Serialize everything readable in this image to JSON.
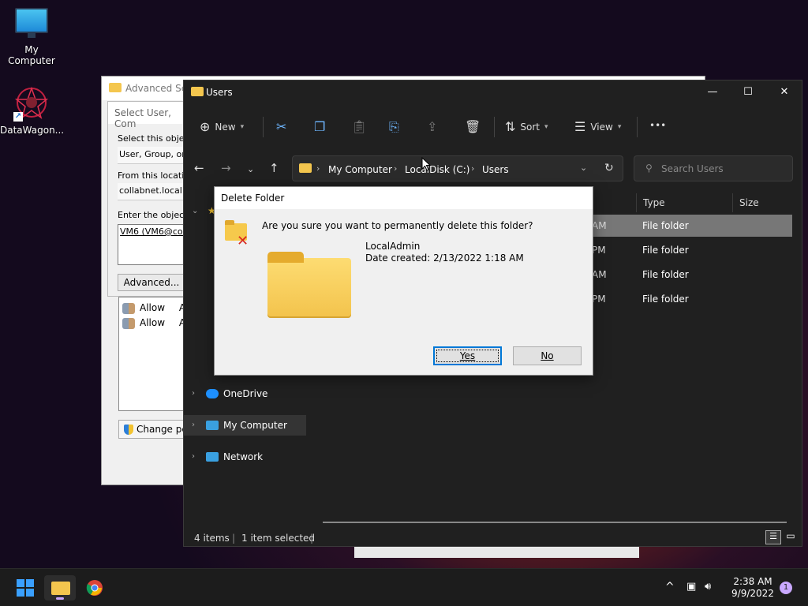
{
  "desktop": {
    "icons": [
      {
        "label": "My Computer"
      },
      {
        "label": "DataWagon..."
      }
    ]
  },
  "adv_security": {
    "title": "Advanced Sec",
    "select_user": {
      "title": "Select User, Com",
      "select_type_label": "Select this object",
      "select_type_value": "User, Group, or B",
      "location_label": "From this location:",
      "location_value": "collabnet.local",
      "enter_label": "Enter the object n",
      "enter_value": "VM6 (VM6@colla",
      "advanced_button": "Advanced..."
    },
    "permissions": [
      {
        "type": "Allow",
        "extra": "A"
      },
      {
        "type": "Allow",
        "extra": "A"
      }
    ],
    "change_button": "Change pe"
  },
  "explorer": {
    "title": "Users",
    "window_controls": {
      "minimize": "—",
      "maximize": "☐",
      "close": "✕"
    },
    "toolbar": {
      "new_label": "New",
      "sort_label": "Sort",
      "view_label": "View",
      "more_label": "•••"
    },
    "address": {
      "crumbs": [
        "My Computer",
        "LocalDisk (C:)",
        "Users"
      ]
    },
    "search": {
      "placeholder": "Search Users"
    },
    "columns": {
      "type": "Type",
      "size": "Size"
    },
    "rows": [
      {
        "date_fragment": "AM",
        "type": "File folder",
        "selected": true
      },
      {
        "date_fragment": "PM",
        "type": "File folder",
        "selected": false
      },
      {
        "date_fragment": "AM",
        "type": "File folder",
        "selected": false
      },
      {
        "date_fragment": "PM",
        "type": "File folder",
        "selected": false
      }
    ],
    "nav": [
      {
        "label": "OneDrive",
        "color": "#1e90ff"
      },
      {
        "label": "My Computer",
        "color": "#3aa0e0"
      },
      {
        "label": "Network",
        "color": "#3aa0e0"
      }
    ],
    "status": {
      "items": "4 items",
      "selected": "1 item selected",
      "separator": "|"
    }
  },
  "delete_dialog": {
    "title": "Delete Folder",
    "question": "Are you sure you want to permanently delete this folder?",
    "folder_name": "LocalAdmin",
    "date_created": "Date created: 2/13/2022 1:18 AM",
    "yes_label": "Yes",
    "no_label": "No"
  },
  "taskbar": {
    "time": "2:38 AM",
    "date": "9/9/2022",
    "notification_count": "1"
  },
  "colors": {
    "accent": "#0078d7",
    "folder": "#f4c64e",
    "dark_bg": "#202020"
  }
}
